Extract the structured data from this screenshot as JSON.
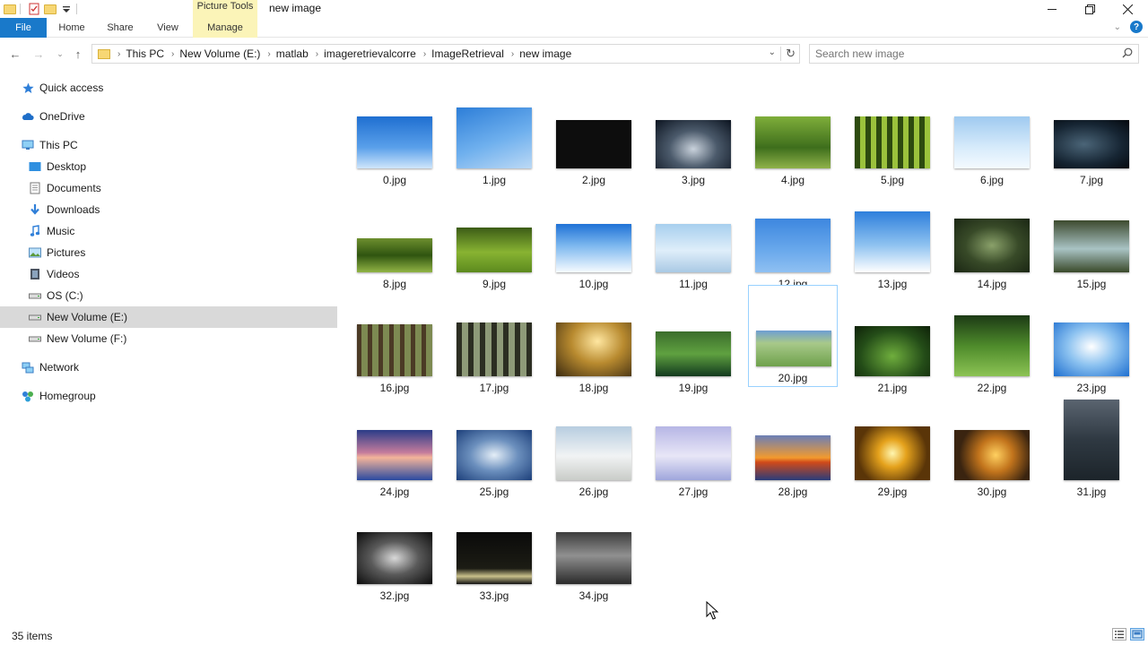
{
  "window": {
    "title": "new image",
    "contextual_group": "Picture Tools",
    "controls": [
      "minimize",
      "maximize",
      "close"
    ]
  },
  "ribbon": {
    "tabs": [
      "File",
      "Home",
      "Share",
      "View",
      "Manage"
    ]
  },
  "address": {
    "path": [
      "This PC",
      "New Volume (E:)",
      "matlab",
      "imageretrievalcorre",
      "ImageRetrieval",
      "new image"
    ]
  },
  "search": {
    "placeholder": "Search new image"
  },
  "sidebar": {
    "items": [
      {
        "label": "Quick access",
        "icon": "star-icon",
        "indent": 0
      },
      {
        "label": "OneDrive",
        "icon": "cloud-icon",
        "indent": 0
      },
      {
        "label": "This PC",
        "icon": "computer-icon",
        "indent": 0
      },
      {
        "label": "Desktop",
        "icon": "desktop-icon",
        "indent": 1
      },
      {
        "label": "Documents",
        "icon": "documents-icon",
        "indent": 1
      },
      {
        "label": "Downloads",
        "icon": "downloads-icon",
        "indent": 1
      },
      {
        "label": "Music",
        "icon": "music-icon",
        "indent": 1
      },
      {
        "label": "Pictures",
        "icon": "pictures-icon",
        "indent": 1
      },
      {
        "label": "Videos",
        "icon": "videos-icon",
        "indent": 1
      },
      {
        "label": "OS (C:)",
        "icon": "drive-icon",
        "indent": 1
      },
      {
        "label": "New Volume (E:)",
        "icon": "drive-icon",
        "indent": 1,
        "selected": true
      },
      {
        "label": "New Volume (F:)",
        "icon": "drive-icon",
        "indent": 1
      },
      {
        "label": "Network",
        "icon": "network-icon",
        "indent": 0
      },
      {
        "label": "Homegroup",
        "icon": "homegroup-icon",
        "indent": 0
      }
    ]
  },
  "files": [
    {
      "name": "0.jpg",
      "bg": "linear-gradient(180deg,#1f6fd1,#5aa0ea 60%,#cfe6fb)"
    },
    {
      "name": "1.jpg",
      "bg": "linear-gradient(160deg,#2d7ed8,#6fb0ee 55%,#bcd9f5)"
    },
    {
      "name": "2.jpg",
      "bg": "#0d0d0d"
    },
    {
      "name": "3.jpg",
      "bg": "radial-gradient(ellipse at 50% 60%,#c9d2dc,#4b5a6b 45%,#0c1420)"
    },
    {
      "name": "4.jpg",
      "bg": "linear-gradient(180deg,#7fae3a,#3e6e1c 60%,#8fb24a)"
    },
    {
      "name": "5.jpg",
      "bg": "repeating-linear-gradient(90deg,#2d4a0f 0 6px,#9bc23c 6px 12px)"
    },
    {
      "name": "6.jpg",
      "bg": "linear-gradient(180deg,#9fcaf0,#d7ebfb 60%,#f4faff)"
    },
    {
      "name": "7.jpg",
      "bg": "radial-gradient(ellipse at 40% 50%,#4b6578,#162533 60%,#05090e)"
    },
    {
      "name": "8.jpg",
      "bg": "linear-gradient(180deg,#6d8f2e,#2f5410 50%,#91b445)"
    },
    {
      "name": "9.jpg",
      "bg": "linear-gradient(180deg,#3c5c16,#88b332 55%,#5c8a1e)"
    },
    {
      "name": "10.jpg",
      "bg": "linear-gradient(180deg,#1f72d6,#7db8ef 45%,#f6fbff)"
    },
    {
      "name": "11.jpg",
      "bg": "linear-gradient(180deg,#a7cfee,#dfeefa 55%,#a9c9e4)"
    },
    {
      "name": "12.jpg",
      "bg": "linear-gradient(180deg,#3d87df,#6aa9ec 60%,#8fc0f2)"
    },
    {
      "name": "13.jpg",
      "bg": "linear-gradient(180deg,#2e7fdc,#8ec2f0 55%,#ffffff)"
    },
    {
      "name": "14.jpg",
      "bg": "radial-gradient(ellipse at 50% 50%,#8aa16a,#384a28 50%,#1a2613)"
    },
    {
      "name": "15.jpg",
      "bg": "linear-gradient(180deg,#3d4a2e,#a9c3c4 55%,#3a4a2a)"
    },
    {
      "name": "16.jpg",
      "bg": "repeating-linear-gradient(90deg,#4b3a25 0 5px,#7d8a52 5px 12px)"
    },
    {
      "name": "17.jpg",
      "bg": "repeating-linear-gradient(90deg,#2c2e22 0 6px,#8e9a78 6px 13px)"
    },
    {
      "name": "18.jpg",
      "bg": "radial-gradient(ellipse at 55% 35%,#ffe7a1,#b88a2f 45%,#3b2a10)"
    },
    {
      "name": "19.jpg",
      "bg": "linear-gradient(180deg,#3b6d2c,#5fa140 50%,#123a1e)"
    },
    {
      "name": "20.jpg",
      "bg": "linear-gradient(180deg,#6e9fd3,#a8c98a 35%,#6ea14b)"
    },
    {
      "name": "21.jpg",
      "bg": "radial-gradient(ellipse at 50% 60%,#6fae3d,#244d18 60%,#0e2108)"
    },
    {
      "name": "22.jpg",
      "bg": "linear-gradient(180deg,#1c3a15,#4e8b2b 50%,#8cc354)"
    },
    {
      "name": "23.jpg",
      "bg": "radial-gradient(ellipse at 50% 45%,#ffffff,#8cc2f0 45%,#1e6fd0)"
    },
    {
      "name": "24.jpg",
      "bg": "linear-gradient(180deg,#2b3c88,#c47c9c 45%,#f3b49a 55%,#2a4aa0)"
    },
    {
      "name": "25.jpg",
      "bg": "radial-gradient(ellipse at 50% 50%,#e4eef7,#6b8fbd 45%,#1c3f7a)"
    },
    {
      "name": "26.jpg",
      "bg": "linear-gradient(180deg,#b7cde0,#f1f3f4 55%,#c9ccc8)"
    },
    {
      "name": "27.jpg",
      "bg": "linear-gradient(180deg,#b6b6e5,#e8e6f7 55%,#9fa6dc)"
    },
    {
      "name": "28.jpg",
      "bg": "linear-gradient(180deg,#6b7fb7,#f29a2e 50%,#d04a1a 60%,#2a3c7a)"
    },
    {
      "name": "29.jpg",
      "bg": "radial-gradient(circle at 50% 50%,#fff6b0,#e5a21c 30%,#5a3508 75%)"
    },
    {
      "name": "30.jpg",
      "bg": "radial-gradient(circle at 55% 50%,#ffd060,#c2741c 35%,#3a2410 75%)"
    },
    {
      "name": "31.jpg",
      "bg": "linear-gradient(180deg,#5a6470,#2f3942 50%,#1c242a)"
    },
    {
      "name": "32.jpg",
      "bg": "radial-gradient(ellipse at 50% 50%,#d9d9d9,#5a5a5a 45%,#0c0c0c)"
    },
    {
      "name": "33.jpg",
      "bg": "linear-gradient(180deg,#0a0a0a,#1c1c14 70%,#c9c08a 85%,#111)"
    },
    {
      "name": "34.jpg",
      "bg": "linear-gradient(180deg,#3c3c3c,#909090 45%,#2a2a2a)"
    }
  ],
  "status": {
    "item_count": "35 items"
  }
}
